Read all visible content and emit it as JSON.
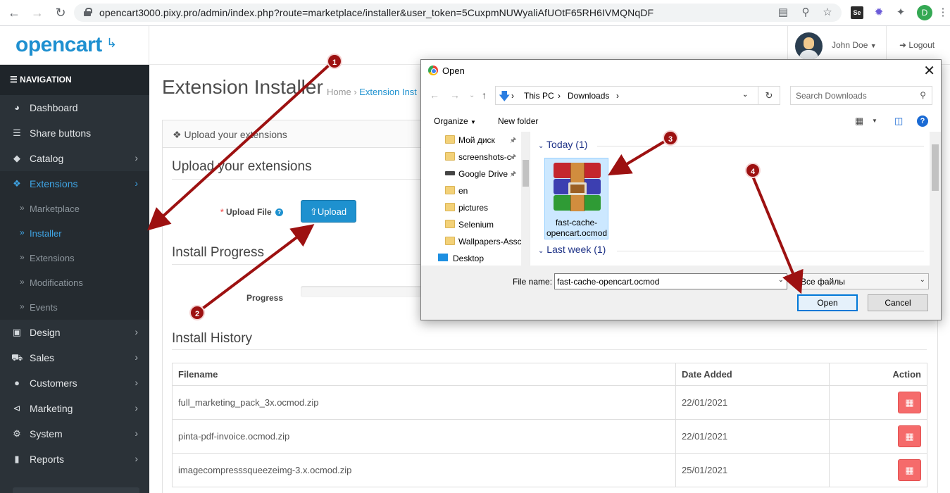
{
  "browser": {
    "url": "opencart3000.pixy.pro/admin/index.php?route=marketplace/installer&user_token=5CuxpmNUWyaliAfUOtF65RH6IVMQNqDF",
    "profile_initial": "D",
    "ext_badge": "Se"
  },
  "header": {
    "logo_text": "opencart",
    "user_name": "John Doe",
    "logout_label": "Logout"
  },
  "sidebar": {
    "heading": "NAVIGATION",
    "items": [
      {
        "label": "Dashboard",
        "icon": "dashboard-icon"
      },
      {
        "label": "Share buttons",
        "icon": "list-icon"
      },
      {
        "label": "Catalog",
        "icon": "tag-icon"
      },
      {
        "label": "Extensions",
        "icon": "puzzle-icon"
      },
      {
        "label": "Design",
        "icon": "monitor-icon"
      },
      {
        "label": "Sales",
        "icon": "cart-icon"
      },
      {
        "label": "Customers",
        "icon": "user-icon"
      },
      {
        "label": "Marketing",
        "icon": "share-icon"
      },
      {
        "label": "System",
        "icon": "gear-icon"
      },
      {
        "label": "Reports",
        "icon": "bar-chart-icon"
      }
    ],
    "sub_items": [
      "Marketplace",
      "Installer",
      "Extensions",
      "Modifications",
      "Events"
    ]
  },
  "page": {
    "title": "Extension Installer",
    "breadcrumb_home": "Home",
    "breadcrumb_current": "Extension Inst",
    "panel_heading": "Upload your extensions",
    "upload_legend": "Upload your extensions",
    "upload_label": "Upload File",
    "upload_button": "Upload",
    "progress_legend": "Install Progress",
    "progress_label": "Progress",
    "history_legend": "Install History",
    "table_headers": {
      "filename": "Filename",
      "date": "Date Added",
      "action": "Action"
    },
    "history_rows": [
      {
        "filename": "full_marketing_pack_3x.ocmod.zip",
        "date": "22/01/2021"
      },
      {
        "filename": "pinta-pdf-invoice.ocmod.zip",
        "date": "22/01/2021"
      },
      {
        "filename": "imagecompresssqueezeimg-3.x.ocmod.zip",
        "date": "25/01/2021"
      }
    ]
  },
  "dialog": {
    "title": "Open",
    "crumb_1": "This PC",
    "crumb_2": "Downloads",
    "search_placeholder": "Search Downloads",
    "organize_label": "Organize",
    "new_folder_label": "New folder",
    "tree_items": [
      {
        "label": "Мой диск",
        "type": "folder",
        "pinned": true
      },
      {
        "label": "screenshots-c",
        "type": "folder",
        "pinned": true
      },
      {
        "label": "Google Drive",
        "type": "drive",
        "pinned": true
      },
      {
        "label": "en",
        "type": "folder",
        "pinned": false
      },
      {
        "label": "pictures",
        "type": "folder",
        "pinned": false
      },
      {
        "label": "Selenium",
        "type": "folder",
        "pinned": false
      },
      {
        "label": "Wallpapers-Assc",
        "type": "folder",
        "pinned": false
      },
      {
        "label": "Desktop",
        "type": "desktop",
        "pinned": false
      }
    ],
    "group_today": "Today (1)",
    "group_last_week": "Last week (1)",
    "file_name_tile": "fast-cache-opencart.ocmod",
    "file_name_label": "File name:",
    "file_name_value": "fast-cache-opencart.ocmod",
    "file_type_value": "Все файлы",
    "open_button": "Open",
    "cancel_button": "Cancel"
  },
  "annotations": [
    "1",
    "2",
    "3",
    "4"
  ],
  "colors": {
    "accent": "#1e91cf",
    "sidebar_bg": "#2b3238",
    "danger": "#f56b6b",
    "annotation": "#9d1111"
  }
}
